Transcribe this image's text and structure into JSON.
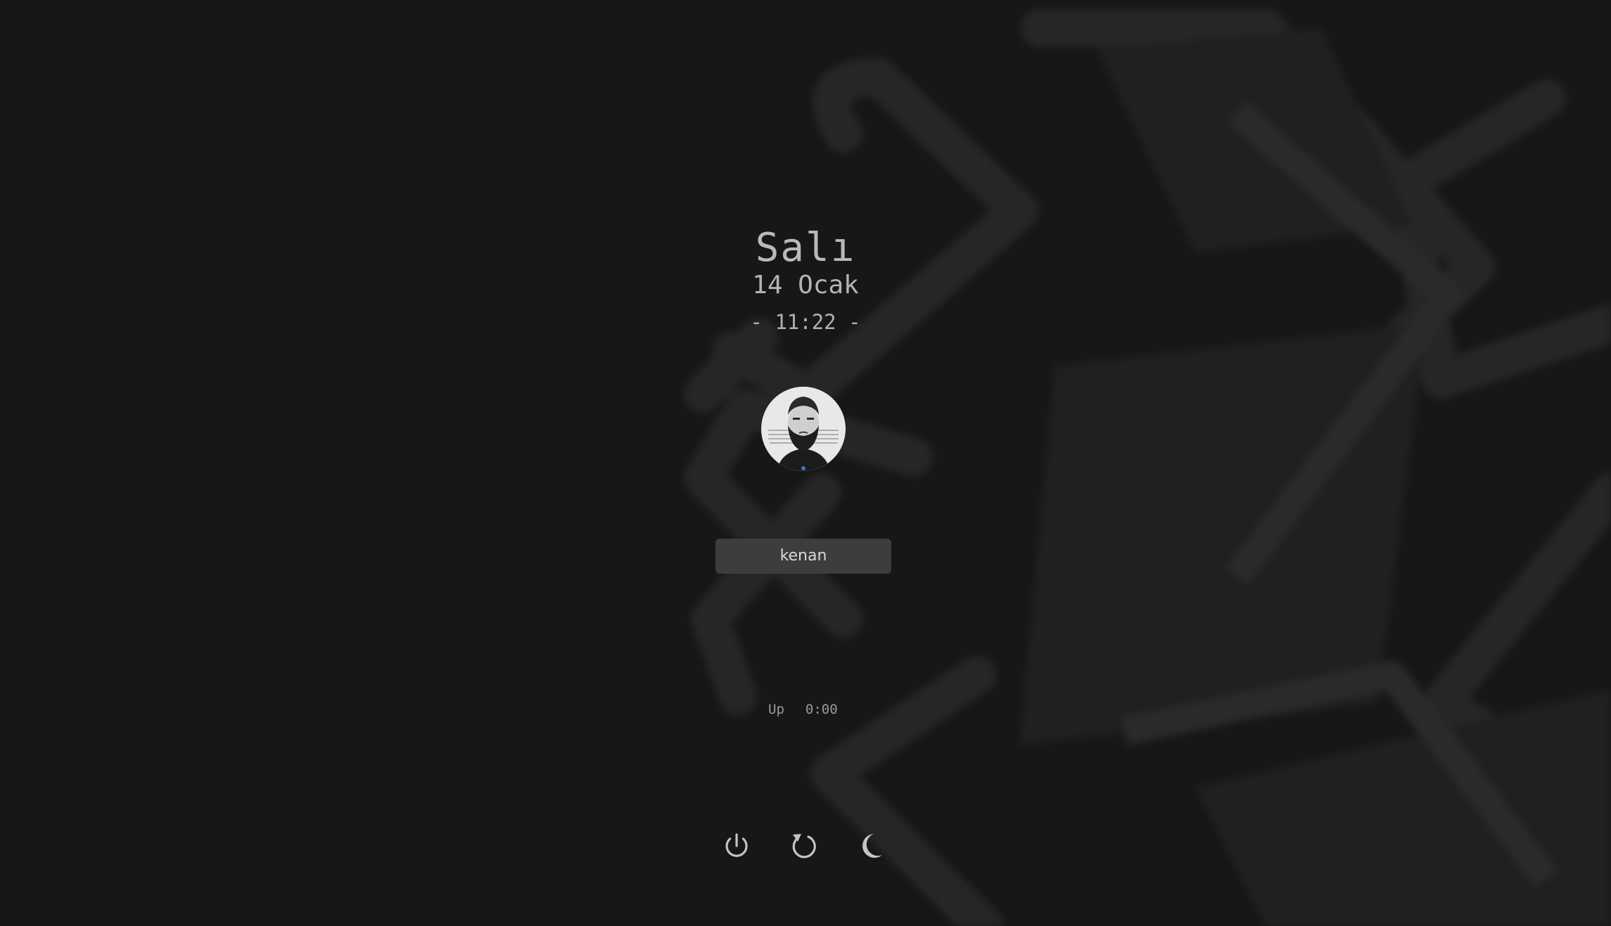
{
  "lockscreen": {
    "day": "Salı",
    "date": "14 Ocak",
    "time": "- 11:22 -",
    "username": "kenan",
    "uptime_label": "Up",
    "uptime_value": "0:00"
  },
  "actions": {
    "shutdown_icon": "power-icon",
    "restart_icon": "restart-icon",
    "suspend_icon": "moon-icon"
  },
  "colors": {
    "background": "#171717",
    "text": "#b9b9b9",
    "input_bg": "#3d3d3d",
    "icon": "#c4c4c4"
  }
}
